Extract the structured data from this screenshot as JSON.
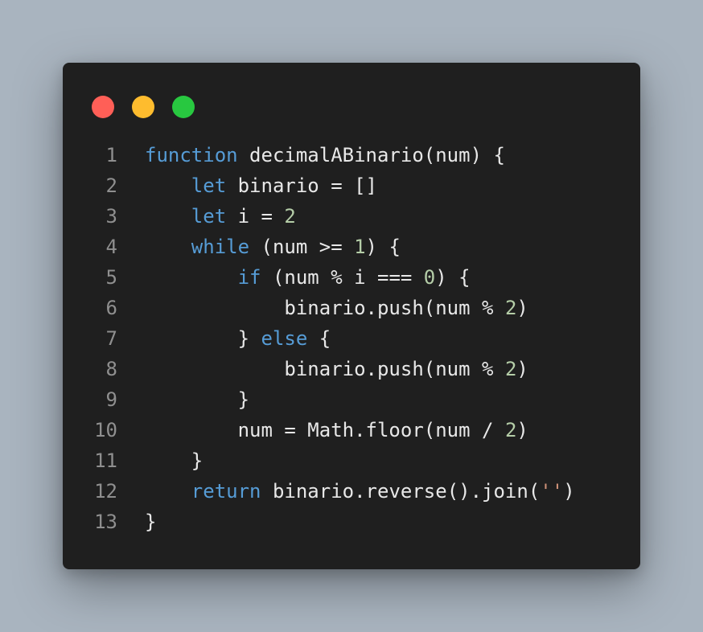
{
  "window_controls": {
    "close_color": "#ff5f57",
    "minimize_color": "#febc2e",
    "maximize_color": "#28c840"
  },
  "code": {
    "lines": [
      {
        "number": "1",
        "indent": "",
        "tokens": [
          {
            "t": "kw",
            "v": "function"
          },
          {
            "t": "pl",
            "v": " decimalABinario(num) {"
          }
        ]
      },
      {
        "number": "2",
        "indent": "    ",
        "tokens": [
          {
            "t": "kw",
            "v": "let"
          },
          {
            "t": "pl",
            "v": " binario = []"
          }
        ]
      },
      {
        "number": "3",
        "indent": "    ",
        "tokens": [
          {
            "t": "kw",
            "v": "let"
          },
          {
            "t": "pl",
            "v": " i = "
          },
          {
            "t": "num",
            "v": "2"
          }
        ]
      },
      {
        "number": "4",
        "indent": "    ",
        "tokens": [
          {
            "t": "kw",
            "v": "while"
          },
          {
            "t": "pl",
            "v": " (num >= "
          },
          {
            "t": "num",
            "v": "1"
          },
          {
            "t": "pl",
            "v": ") {"
          }
        ]
      },
      {
        "number": "5",
        "indent": "        ",
        "tokens": [
          {
            "t": "kw",
            "v": "if"
          },
          {
            "t": "pl",
            "v": " (num % i === "
          },
          {
            "t": "num",
            "v": "0"
          },
          {
            "t": "pl",
            "v": ") {"
          }
        ]
      },
      {
        "number": "6",
        "indent": "            ",
        "tokens": [
          {
            "t": "pl",
            "v": "binario.push(num % "
          },
          {
            "t": "num",
            "v": "2"
          },
          {
            "t": "pl",
            "v": ")"
          }
        ]
      },
      {
        "number": "7",
        "indent": "        ",
        "tokens": [
          {
            "t": "pl",
            "v": "} "
          },
          {
            "t": "kw",
            "v": "else"
          },
          {
            "t": "pl",
            "v": " {"
          }
        ]
      },
      {
        "number": "8",
        "indent": "            ",
        "tokens": [
          {
            "t": "pl",
            "v": "binario.push(num % "
          },
          {
            "t": "num",
            "v": "2"
          },
          {
            "t": "pl",
            "v": ")"
          }
        ]
      },
      {
        "number": "9",
        "indent": "        ",
        "tokens": [
          {
            "t": "pl",
            "v": "}"
          }
        ]
      },
      {
        "number": "10",
        "indent": "        ",
        "tokens": [
          {
            "t": "pl",
            "v": "num = Math.floor(num / "
          },
          {
            "t": "num",
            "v": "2"
          },
          {
            "t": "pl",
            "v": ")"
          }
        ]
      },
      {
        "number": "11",
        "indent": "    ",
        "tokens": [
          {
            "t": "pl",
            "v": "}"
          }
        ]
      },
      {
        "number": "12",
        "indent": "    ",
        "tokens": [
          {
            "t": "kw",
            "v": "return"
          },
          {
            "t": "pl",
            "v": " binario.reverse().join("
          },
          {
            "t": "str",
            "v": "''"
          },
          {
            "t": "pl",
            "v": ")"
          }
        ]
      },
      {
        "number": "13",
        "indent": "",
        "tokens": [
          {
            "t": "pl",
            "v": "}"
          }
        ]
      }
    ]
  }
}
